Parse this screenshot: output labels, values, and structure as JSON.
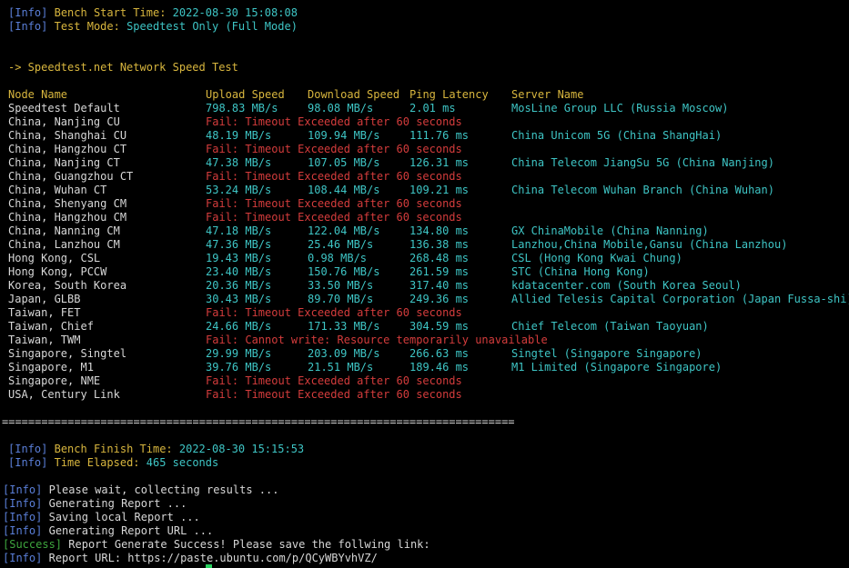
{
  "colors": {
    "info_tag": "#5a7fd8",
    "cyan": "#3ec5c5",
    "gold": "#d8b63e",
    "fail": "#d43c3c",
    "text": "#d7d7d7",
    "success": "#3ea63e",
    "cursor": "#27d15e",
    "background": "#000000"
  },
  "header": {
    "start_tag": "[Info]",
    "start_label": "Bench Start Time:",
    "start_value": "2022-08-30 15:08:08",
    "mode_tag": "[Info]",
    "mode_label": "Test Mode:",
    "mode_value": "Speedtest Only (Full Mode)"
  },
  "section_title": "-> Speedtest.net Network Speed Test",
  "columns": {
    "node": "Node Name",
    "upload": "Upload Speed",
    "download": "Download Speed",
    "ping": "Ping Latency",
    "server": "Server Name"
  },
  "rows": [
    {
      "node": "Speedtest Default",
      "up": "798.83 MB/s",
      "down": "98.08 MB/s",
      "ping": "2.01 ms",
      "server": "MosLine Group LLC (Russia Moscow)"
    },
    {
      "node": "China, Nanjing CU",
      "fail": "Fail: Timeout Exceeded after 60 seconds"
    },
    {
      "node": "China, Shanghai CU",
      "up": "48.19 MB/s",
      "down": "109.94 MB/s",
      "ping": "111.76 ms",
      "server": "China Unicom 5G (China ShangHai)"
    },
    {
      "node": "China, Hangzhou CT",
      "fail": "Fail: Timeout Exceeded after 60 seconds"
    },
    {
      "node": "China, Nanjing CT",
      "up": "47.38 MB/s",
      "down": "107.05 MB/s",
      "ping": "126.31 ms",
      "server": "China Telecom JiangSu 5G (China Nanjing)"
    },
    {
      "node": "China, Guangzhou CT",
      "fail": "Fail: Timeout Exceeded after 60 seconds"
    },
    {
      "node": "China, Wuhan CT",
      "up": "53.24 MB/s",
      "down": "108.44 MB/s",
      "ping": "109.21 ms",
      "server": "China Telecom Wuhan Branch (China Wuhan)"
    },
    {
      "node": "China, Shenyang CM",
      "fail": "Fail: Timeout Exceeded after 60 seconds"
    },
    {
      "node": "China, Hangzhou CM",
      "fail": "Fail: Timeout Exceeded after 60 seconds"
    },
    {
      "node": "China, Nanning CM",
      "up": "47.18 MB/s",
      "down": "122.04 MB/s",
      "ping": "134.80 ms",
      "server": "GX ChinaMobile (China Nanning)"
    },
    {
      "node": "China, Lanzhou CM",
      "up": "47.36 MB/s",
      "down": "25.46 MB/s",
      "ping": "136.38 ms",
      "server": "Lanzhou,China Mobile,Gansu (China Lanzhou)"
    },
    {
      "node": "Hong Kong, CSL",
      "up": "19.43 MB/s",
      "down": "0.98 MB/s",
      "ping": "268.48 ms",
      "server": "CSL (Hong Kong Kwai Chung)"
    },
    {
      "node": "Hong Kong, PCCW",
      "up": "23.40 MB/s",
      "down": "150.76 MB/s",
      "ping": "261.59 ms",
      "server": "STC (China Hong Kong)"
    },
    {
      "node": "Korea, South Korea",
      "up": "20.36 MB/s",
      "down": "33.50 MB/s",
      "ping": "317.40 ms",
      "server": "kdatacenter.com (South Korea Seoul)"
    },
    {
      "node": "Japan, GLBB",
      "up": "30.43 MB/s",
      "down": "89.70 MB/s",
      "ping": "249.36 ms",
      "server": "Allied Telesis Capital Corporation (Japan Fussa-shi)"
    },
    {
      "node": "Taiwan, FET",
      "fail": "Fail: Timeout Exceeded after 60 seconds"
    },
    {
      "node": "Taiwan, Chief",
      "up": "24.66 MB/s",
      "down": "171.33 MB/s",
      "ping": "304.59 ms",
      "server": "Chief Telecom (Taiwan Taoyuan)"
    },
    {
      "node": "Taiwan, TWM",
      "fail": "Fail: Cannot write: Resource temporarily unavailable"
    },
    {
      "node": "Singapore, Singtel",
      "up": "29.99 MB/s",
      "down": "203.09 MB/s",
      "ping": "266.63 ms",
      "server": "Singtel (Singapore Singapore)"
    },
    {
      "node": "Singapore, M1",
      "up": "39.76 MB/s",
      "down": "21.51 MB/s",
      "ping": "189.46 ms",
      "server": "M1 Limited (Singapore Singapore)"
    },
    {
      "node": "Singapore, NME",
      "fail": "Fail: Timeout Exceeded after 60 seconds"
    },
    {
      "node": "USA, Century Link",
      "fail": "Fail: Timeout Exceeded after 60 seconds"
    }
  ],
  "separator": "==============================================================================",
  "footer": {
    "finish_tag": "[Info]",
    "finish_label": "Bench Finish Time:",
    "finish_value": "2022-08-30 15:15:53",
    "elapsed_tag": "[Info]",
    "elapsed_label": "Time Elapsed:",
    "elapsed_value": "465 seconds"
  },
  "log": [
    {
      "tag": "[Info]",
      "text": "Please wait, collecting results ..."
    },
    {
      "tag": "[Info]",
      "text": "Generating Report ..."
    },
    {
      "tag": "[Info]",
      "text": "Saving local Report ..."
    },
    {
      "tag": "[Info]",
      "text": "Generating Report URL ..."
    },
    {
      "tag": "[Success]",
      "text": "Report Generate Success! Please save the follwing link:",
      "success": true
    },
    {
      "tag": "[Info]",
      "text": "Report URL: https://paste.ubuntu.com/p/QCyWBYvhVZ/"
    }
  ]
}
